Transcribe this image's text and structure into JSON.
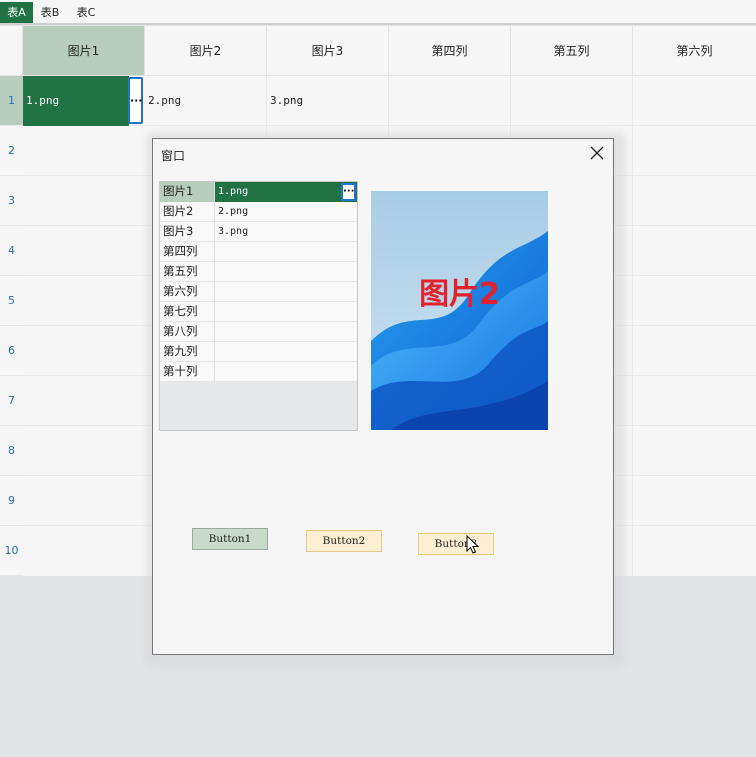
{
  "sheet_tabs": [
    {
      "label": "表A",
      "active": true
    },
    {
      "label": "表B",
      "active": false
    },
    {
      "label": "表C",
      "active": false
    }
  ],
  "grid": {
    "columns": [
      "图片1",
      "图片2",
      "图片3",
      "第四列",
      "第五列",
      "第六列"
    ],
    "rows": [
      "1",
      "2",
      "3",
      "4",
      "5",
      "6",
      "7",
      "8",
      "9",
      "10"
    ],
    "row1": {
      "c1": "1.png",
      "c2": "2.png",
      "c3": "3.png"
    },
    "ellipsis": "···"
  },
  "dialog": {
    "title": "窗口",
    "close_icon": "close-icon",
    "properties": [
      {
        "name": "图片1",
        "value": "1.png"
      },
      {
        "name": "图片2",
        "value": "2.png"
      },
      {
        "name": "图片3",
        "value": "3.png"
      },
      {
        "name": "第四列",
        "value": ""
      },
      {
        "name": "第五列",
        "value": ""
      },
      {
        "name": "第六列",
        "value": ""
      },
      {
        "name": "第七列",
        "value": ""
      },
      {
        "name": "第八列",
        "value": ""
      },
      {
        "name": "第九列",
        "value": ""
      },
      {
        "name": "第十列",
        "value": ""
      }
    ],
    "preview_label": "图片2",
    "buttons": {
      "b1": "Button1",
      "b2": "Button2",
      "b3": "Button3"
    }
  },
  "colors": {
    "accent": "#217346",
    "selected_header": "#b8cdbd",
    "button_highlight": "#fdefd2",
    "preview_text": "#e6212b"
  }
}
